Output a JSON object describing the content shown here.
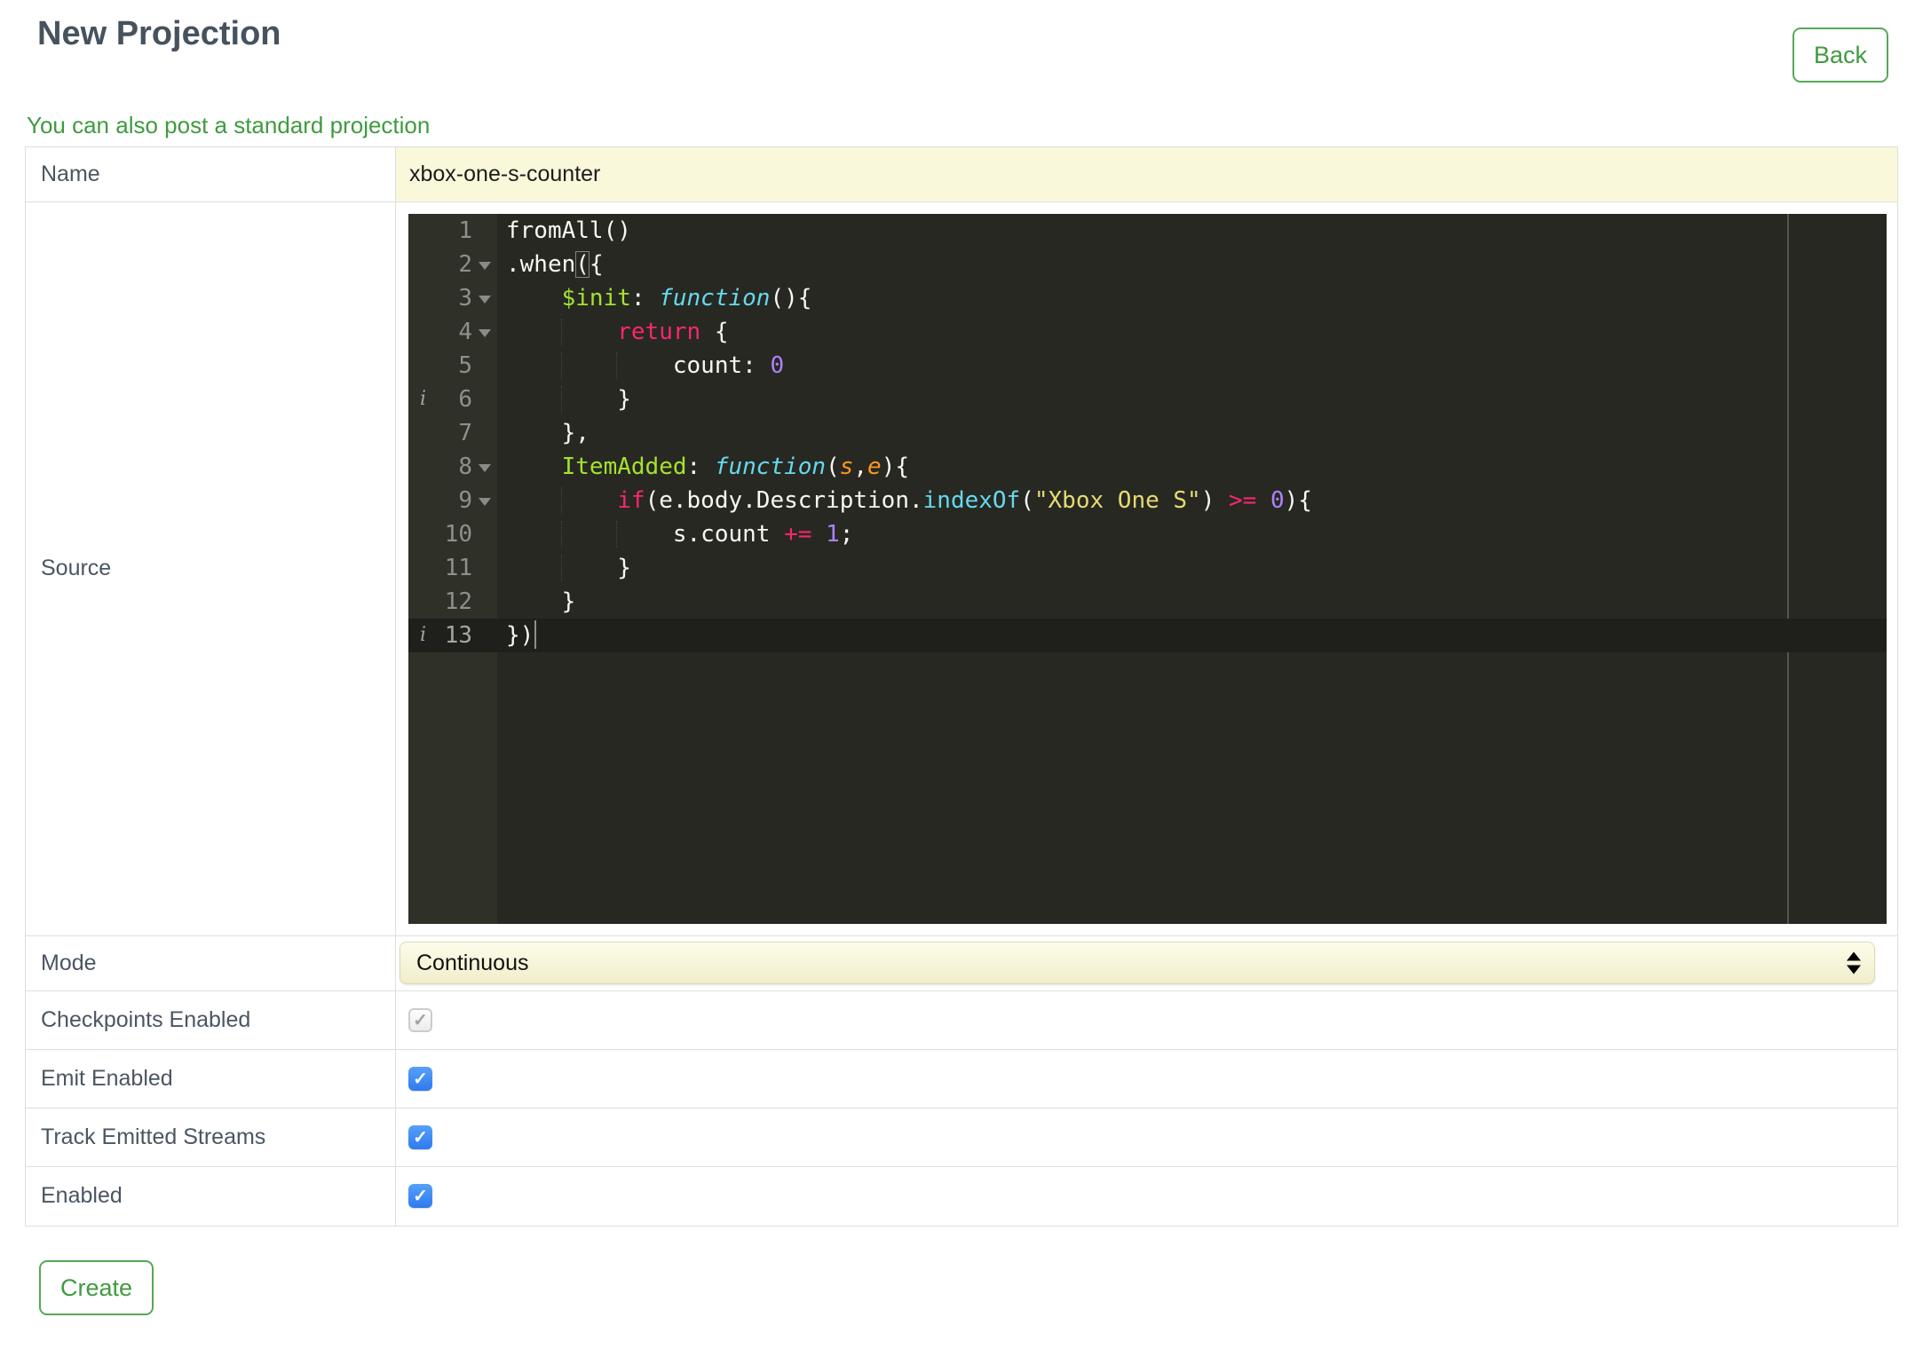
{
  "page": {
    "title": "New Projection"
  },
  "header": {
    "back_label": "Back"
  },
  "link": {
    "text": "You can also post a standard projection"
  },
  "palette": {
    "accent_green": "#3f9b3f",
    "heading_color": "#46535e",
    "input_yellow_bg": "#faf8da",
    "checkbox_blue": "#2e7af0",
    "table_border": "#dedede"
  },
  "form": {
    "name": {
      "label": "Name",
      "value": "xbox-one-s-counter"
    },
    "source": {
      "label": "Source"
    },
    "mode": {
      "label": "Mode",
      "value": "Continuous"
    },
    "checkpoints": {
      "label": "Checkpoints Enabled",
      "checked": true,
      "disabled": true
    },
    "emit": {
      "label": "Emit Enabled",
      "checked": true,
      "disabled": false
    },
    "track": {
      "label": "Track Emitted Streams",
      "checked": true,
      "disabled": false
    },
    "enabled": {
      "label": "Enabled",
      "checked": true,
      "disabled": false
    }
  },
  "editor": {
    "language": "javascript",
    "theme": {
      "name": "monokai",
      "background": "#272822",
      "gutter_background": "#2f3129",
      "gutter_text": "#8f908a",
      "active_line": "#1f201b",
      "text": "#f8f8f2",
      "keyword": "#f92672",
      "entity_name": "#a6e22e",
      "storage_function": "#66d9ef",
      "parameter": "#fd971f",
      "string": "#e6db74",
      "number": "#ae81ff"
    },
    "lines": [
      {
        "num": 1,
        "indent": 0,
        "tokens": [
          [
            "w",
            "fromAll()"
          ]
        ]
      },
      {
        "num": 2,
        "indent": 0,
        "fold": true,
        "tokens": [
          [
            "w",
            ".when"
          ],
          [
            "w",
            "(",
            "brk"
          ],
          [
            "w",
            "{"
          ]
        ]
      },
      {
        "num": 3,
        "indent": 4,
        "fold": true,
        "tokens": [
          [
            "g",
            "$init"
          ],
          [
            "w",
            ": "
          ],
          [
            "ci",
            "function"
          ],
          [
            "w",
            "(){"
          ]
        ]
      },
      {
        "num": 4,
        "indent": 8,
        "fold": true,
        "tokens": [
          [
            "p",
            "return"
          ],
          [
            "w",
            " {"
          ]
        ]
      },
      {
        "num": 5,
        "indent": 12,
        "tokens": [
          [
            "w",
            "count: "
          ],
          [
            "n",
            "0"
          ]
        ]
      },
      {
        "num": 6,
        "indent": 8,
        "info": true,
        "tokens": [
          [
            "w",
            "}"
          ]
        ]
      },
      {
        "num": 7,
        "indent": 4,
        "tokens": [
          [
            "w",
            "},"
          ]
        ]
      },
      {
        "num": 8,
        "indent": 4,
        "fold": true,
        "tokens": [
          [
            "g",
            "ItemAdded"
          ],
          [
            "w",
            ": "
          ],
          [
            "ci",
            "function"
          ],
          [
            "w",
            "("
          ],
          [
            "o",
            "s"
          ],
          [
            "w",
            ","
          ],
          [
            "o",
            "e"
          ],
          [
            "w",
            "){"
          ]
        ]
      },
      {
        "num": 9,
        "indent": 8,
        "fold": true,
        "tokens": [
          [
            "p",
            "if"
          ],
          [
            "w",
            "(e.body.Description."
          ],
          [
            "c",
            "indexOf"
          ],
          [
            "w",
            "("
          ],
          [
            "y",
            "\"Xbox One S\""
          ],
          [
            "w",
            ") "
          ],
          [
            "p",
            ">="
          ],
          [
            "w",
            " "
          ],
          [
            "n",
            "0"
          ],
          [
            "w",
            "){"
          ]
        ]
      },
      {
        "num": 10,
        "indent": 12,
        "tokens": [
          [
            "w",
            "s.count "
          ],
          [
            "p",
            "+="
          ],
          [
            "w",
            " "
          ],
          [
            "n",
            "1"
          ],
          [
            "w",
            ";"
          ]
        ]
      },
      {
        "num": 11,
        "indent": 8,
        "tokens": [
          [
            "w",
            "}"
          ]
        ]
      },
      {
        "num": 12,
        "indent": 4,
        "tokens": [
          [
            "w",
            "}"
          ]
        ]
      },
      {
        "num": 13,
        "indent": 0,
        "info": true,
        "active": true,
        "cursor": true,
        "tokens": [
          [
            "w",
            "})"
          ]
        ]
      }
    ]
  },
  "footer": {
    "create_label": "Create"
  }
}
